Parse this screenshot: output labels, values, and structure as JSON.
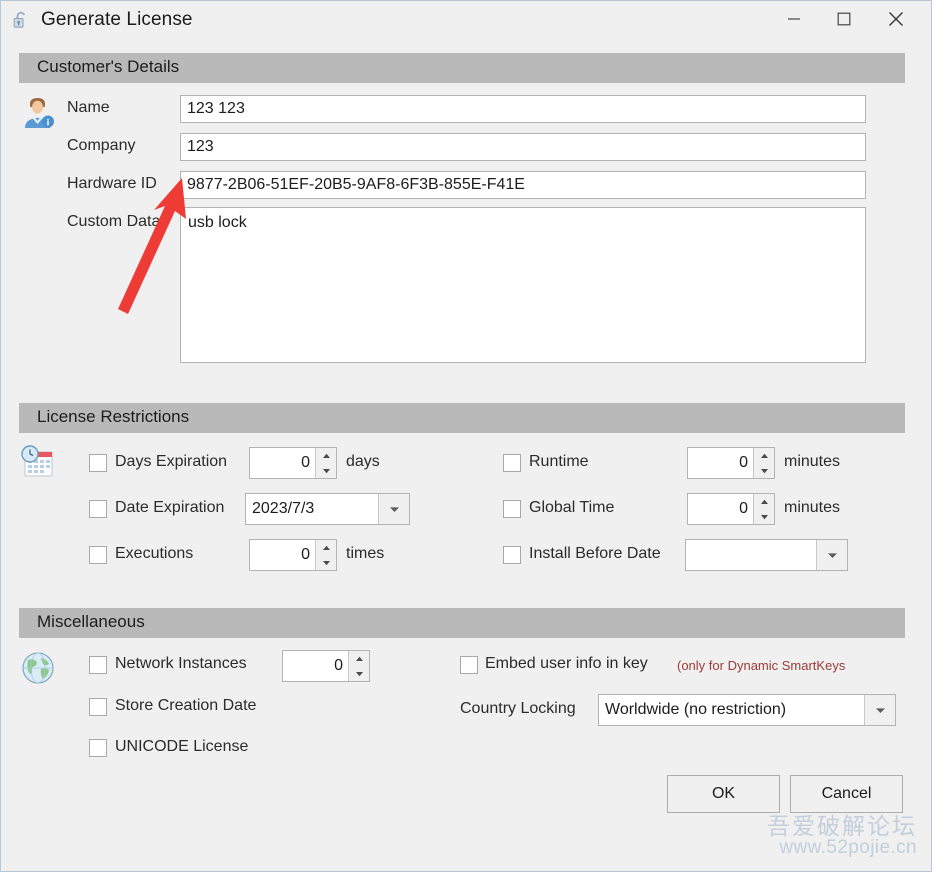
{
  "window": {
    "title": "Generate License",
    "icon": "padlock-icon",
    "controls": {
      "minimize": "minimize-icon",
      "maximize": "maximize-icon",
      "close": "close-icon"
    }
  },
  "sections": {
    "customer": {
      "header": "Customer's Details",
      "icon": "user-avatar-icon",
      "fields": {
        "name_label": "Name",
        "name_value": "123 123",
        "company_label": "Company",
        "company_value": "123",
        "hardware_id_label": "Hardware ID",
        "hardware_id_value": "9877-2B06-51EF-20B5-9AF8-6F3B-855E-F41E",
        "custom_data_label": "Custom Data",
        "custom_data_value": "usb lock"
      }
    },
    "restrictions": {
      "header": "License Restrictions",
      "icon": "calendar-clock-icon",
      "left": [
        {
          "label": "Days Expiration",
          "checked": false,
          "control": "spinner",
          "value": "0",
          "unit": "days"
        },
        {
          "label": "Date Expiration",
          "checked": false,
          "control": "combo",
          "value": "2023/7/3",
          "unit": ""
        },
        {
          "label": "Executions",
          "checked": false,
          "control": "spinner",
          "value": "0",
          "unit": "times"
        }
      ],
      "right": [
        {
          "label": "Runtime",
          "checked": false,
          "control": "spinner",
          "value": "0",
          "unit": "minutes"
        },
        {
          "label": "Global Time",
          "checked": false,
          "control": "spinner",
          "value": "0",
          "unit": "minutes"
        },
        {
          "label": "Install Before Date",
          "checked": false,
          "control": "combo",
          "value": "",
          "unit": ""
        }
      ]
    },
    "misc": {
      "header": "Miscellaneous",
      "icon": "globe-icon",
      "network_instances_label": "Network Instances",
      "network_instances_value": "0",
      "store_creation_date_label": "Store Creation Date",
      "unicode_license_label": "UNICODE License",
      "embed_user_info_label": "Embed user info in key",
      "embed_user_info_note": "(only for Dynamic SmartKeys",
      "country_locking_label": "Country Locking",
      "country_locking_value": "Worldwide (no restriction)"
    }
  },
  "buttons": {
    "ok": "OK",
    "cancel": "Cancel"
  },
  "watermark": {
    "cn": "吾爱破解论坛",
    "url": "www.52pojie.cn"
  },
  "colors": {
    "group_header_bg": "#b9b9b9",
    "window_bg": "#f0f0f0",
    "note_red": "#9e3b3b",
    "arrow_red": "#ef3b35",
    "watermark": "#c3cfdb"
  }
}
